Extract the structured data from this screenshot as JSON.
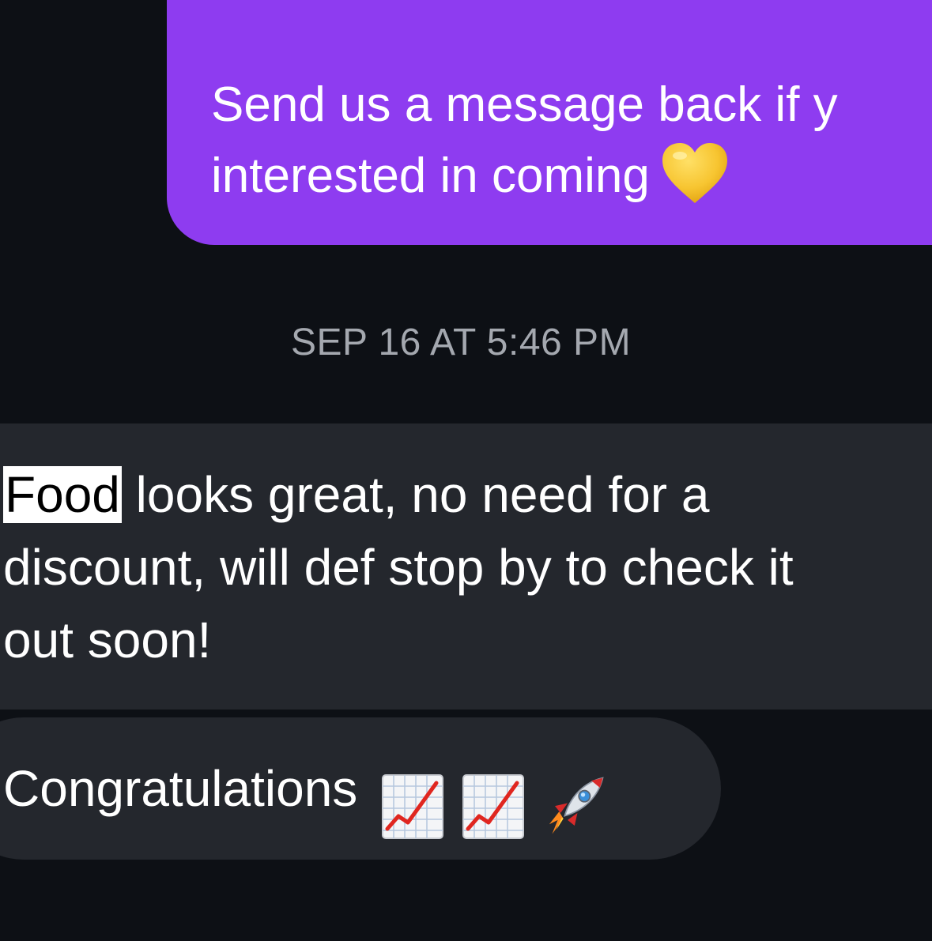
{
  "messages": {
    "sent": {
      "line1": "Send us a message back if y",
      "line2": "interested in coming",
      "emoji": "yellow-heart-icon",
      "bubble_color": "#8e3cf0"
    },
    "timestamp": "SEP 16 AT 5:46 PM",
    "received_1": {
      "highlighted_word": "Food",
      "line1_rest": " looks great, no need for a",
      "line2": "discount, will def stop by to check it",
      "line3": "out soon!",
      "bubble_color": "#24272d"
    },
    "received_2": {
      "text": "Congratulations",
      "emojis": [
        "chart-increasing-icon",
        "chart-increasing-icon",
        "rocket-icon"
      ],
      "bubble_color": "#24272d"
    }
  },
  "colors": {
    "background": "#0d1015",
    "timestamp_text": "#a4a8af",
    "heart": "#f7c531"
  }
}
